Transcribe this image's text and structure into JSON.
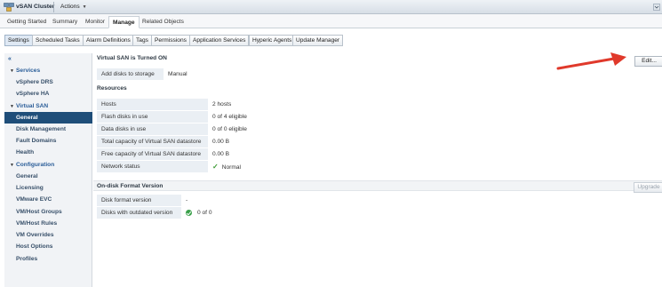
{
  "titlebar": {
    "title": "vSAN Cluster",
    "actions_label": "Actions",
    "icon": "cluster-icon"
  },
  "main_tabs": [
    "Getting Started",
    "Summary",
    "Monitor",
    "Manage",
    "Related Objects"
  ],
  "main_tabs_active": "Manage",
  "sub_tabs": [
    "Settings",
    "Scheduled Tasks",
    "Alarm Definitions",
    "Tags",
    "Permissions",
    "Application Services",
    "Hyperic Agents",
    "Update Manager"
  ],
  "sub_tabs_active": "Settings",
  "sidebar": {
    "collapse_icon": "«",
    "groups": [
      {
        "label": "Services",
        "items": [
          "vSphere DRS",
          "vSphere HA"
        ]
      },
      {
        "label": "Virtual SAN",
        "items": [
          "General",
          "Disk Management",
          "Fault Domains",
          "Health"
        ]
      },
      {
        "label": "Configuration",
        "items": [
          "General",
          "Licensing",
          "VMware EVC",
          "VM/Host Groups",
          "VM/Host Rules",
          "VM Overrides",
          "Host Options",
          "Profiles"
        ]
      }
    ],
    "selected": "General"
  },
  "vsan": {
    "heading": "Virtual SAN is Turned ON",
    "edit_label": "Edit...",
    "add_disks_label": "Add disks to storage",
    "add_disks_value": "Manual"
  },
  "resources": {
    "heading": "Resources",
    "rows": [
      {
        "label": "Hosts",
        "value": "2 hosts"
      },
      {
        "label": "Flash disks in use",
        "value": "0 of 4 eligible"
      },
      {
        "label": "Data disks in use",
        "value": "0 of 0 eligible"
      },
      {
        "label": "Total capacity of Virtual SAN datastore",
        "value": "0.00 B"
      },
      {
        "label": "Free capacity of Virtual SAN datastore",
        "value": "0.00 B"
      },
      {
        "label": "Network status",
        "value": "Normal"
      }
    ]
  },
  "ondisk": {
    "heading": "On-disk Format Version",
    "upgrade_label": "Upgrade",
    "rows": [
      {
        "label": "Disk format version",
        "value": "-"
      },
      {
        "label": "Disks with outdated version",
        "value": "0 of 0"
      }
    ]
  },
  "colors": {
    "accent": "#2a5d98",
    "selected_nav": "#1f4e79",
    "status_ok": "#3aa04a",
    "annotation_arrow": "#e0392b"
  }
}
